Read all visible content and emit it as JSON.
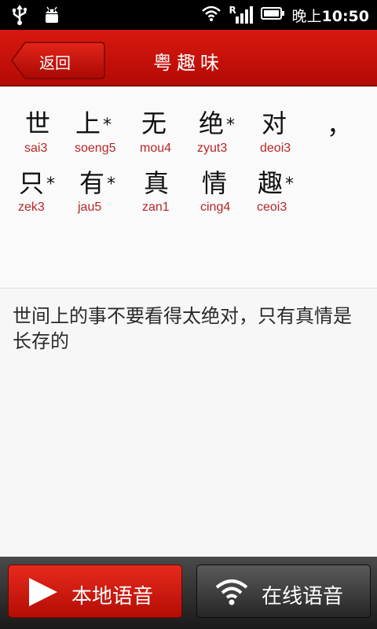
{
  "status_bar": {
    "icons": [
      "usb-icon",
      "android-icon",
      "wifi-icon",
      "signal-roaming-icon",
      "battery-icon"
    ],
    "signal_mark": "R",
    "time_prefix": "晚上",
    "time": "10:50"
  },
  "header": {
    "back_label": "返回",
    "title": "粤趣味"
  },
  "words": [
    {
      "char": "世",
      "star": "",
      "pron": "sai3"
    },
    {
      "char": "上",
      "star": "*",
      "pron": "soeng5"
    },
    {
      "char": "无",
      "star": "",
      "pron": "mou4"
    },
    {
      "char": "绝",
      "star": "*",
      "pron": "zyut3"
    },
    {
      "char": "对",
      "star": "",
      "pron": "deoi3"
    },
    {
      "char": "，",
      "star": "",
      "pron": ""
    },
    {
      "char": "只",
      "star": "*",
      "pron": "zek3"
    },
    {
      "char": "有",
      "star": "*",
      "pron": "jau5"
    },
    {
      "char": "真",
      "star": "",
      "pron": "zan1"
    },
    {
      "char": "情",
      "star": "",
      "pron": "cing4"
    },
    {
      "char": "趣",
      "star": "*",
      "pron": "ceoi3"
    }
  ],
  "translation": "世间上的事不要看得太绝对，只有真情是长存的",
  "bottom": {
    "local_label": "本地语音",
    "online_label": "在线语音"
  },
  "colors": {
    "header_red": "#c8120a",
    "pron_red": "#b52727"
  }
}
